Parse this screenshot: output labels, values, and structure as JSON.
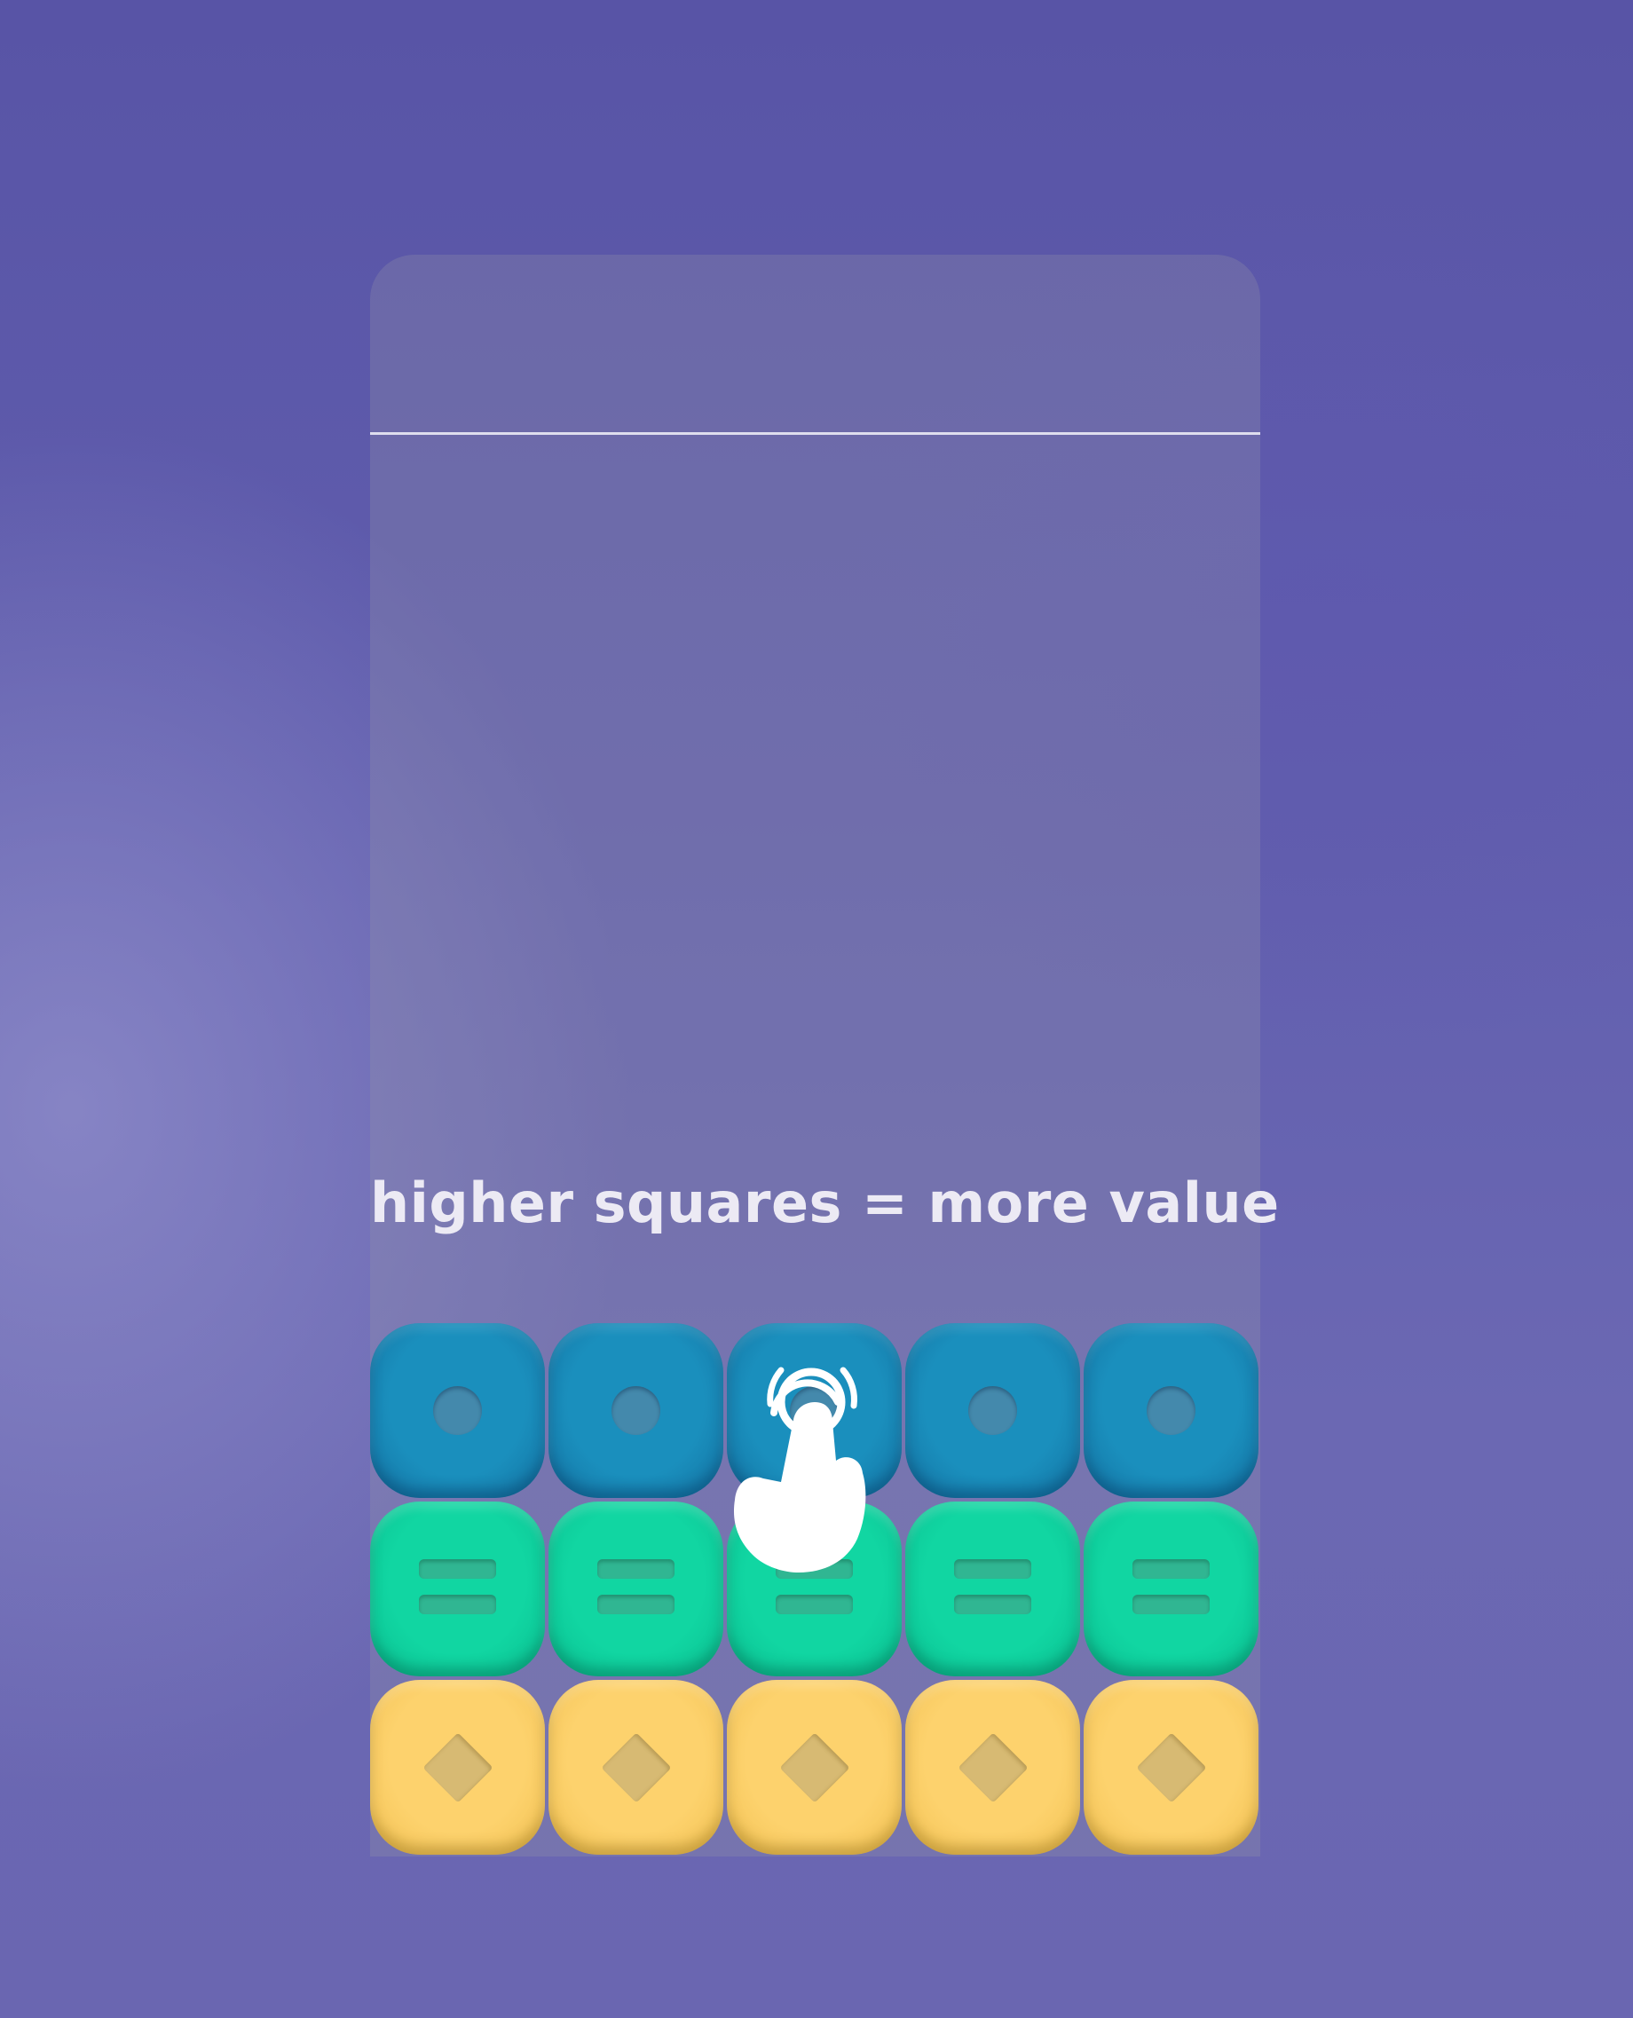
{
  "hint_text": "higher squares = more value",
  "colors": {
    "background": "#5d5aaa",
    "blue_tile": "#1a8fbd",
    "green_tile": "#11d6a2",
    "yellow_tile": "#fdd26d",
    "limit_line": "#ececf5",
    "hint_text": "#eceaf4"
  },
  "grid": {
    "columns": 5,
    "rows": [
      {
        "color": "blue",
        "glyph": "dot-icon"
      },
      {
        "color": "green",
        "glyph": "bars-icon"
      },
      {
        "color": "yellow",
        "glyph": "diamond-icon"
      }
    ]
  },
  "tap_hint": {
    "icon": "tap-hand-icon",
    "column": 3,
    "row": 1
  }
}
